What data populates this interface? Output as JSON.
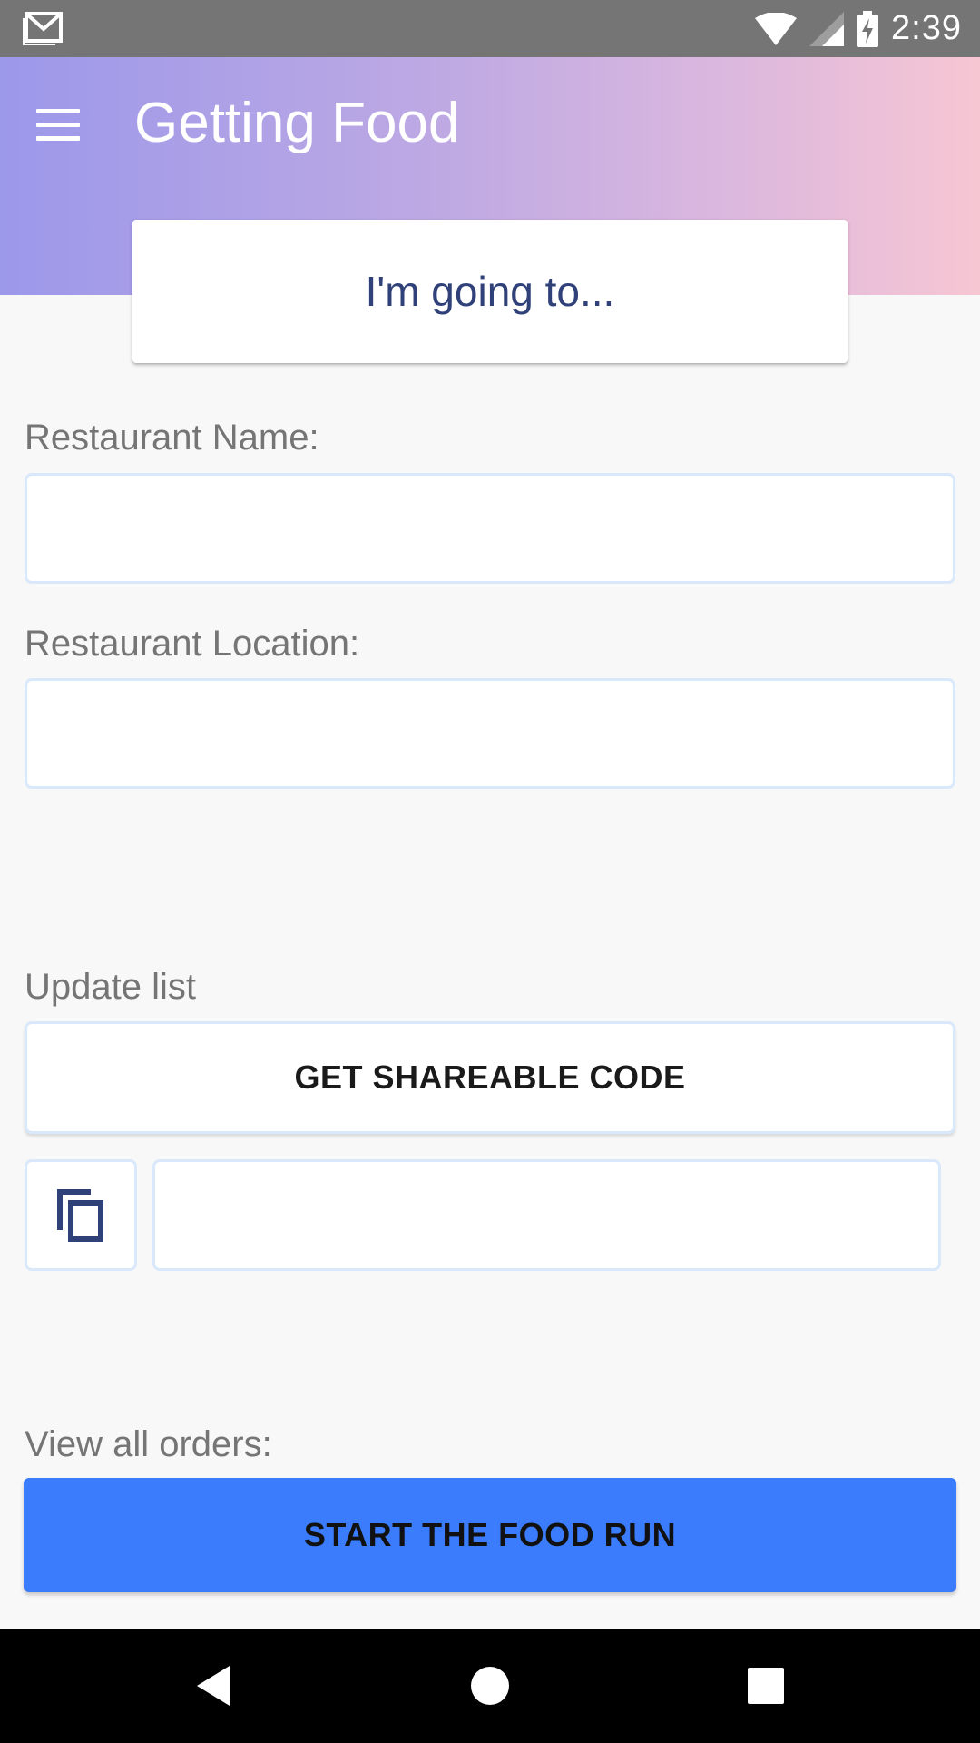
{
  "status_bar": {
    "time": "2:39",
    "icons": [
      "gmail-icon",
      "wifi-icon",
      "signal-icon",
      "battery-charging-icon"
    ]
  },
  "header": {
    "title": "Getting Food",
    "menu_icon": "menu-icon",
    "going_to_text": "I'm going to..."
  },
  "form": {
    "restaurant_name_label": "Restaurant Name:",
    "restaurant_name_value": "",
    "restaurant_location_label": "Restaurant Location:",
    "restaurant_location_value": "",
    "update_list_label": "Update list",
    "shareable_code_button": "GET SHAREABLE CODE",
    "copy_icon": "copy-icon",
    "shareable_code_value": "",
    "view_orders_label": "View all orders:",
    "start_button": "START THE FOOD RUN"
  },
  "nav_bar": {
    "icons": [
      "back-icon",
      "home-icon",
      "recents-icon"
    ]
  },
  "colors": {
    "status_bar": "#757575",
    "header_gradient_start": "#9c98ea",
    "header_gradient_end": "#f7c6d3",
    "accent_text": "#2f4178",
    "primary_button": "#3a7cfc",
    "input_border": "#d9e8fb"
  }
}
